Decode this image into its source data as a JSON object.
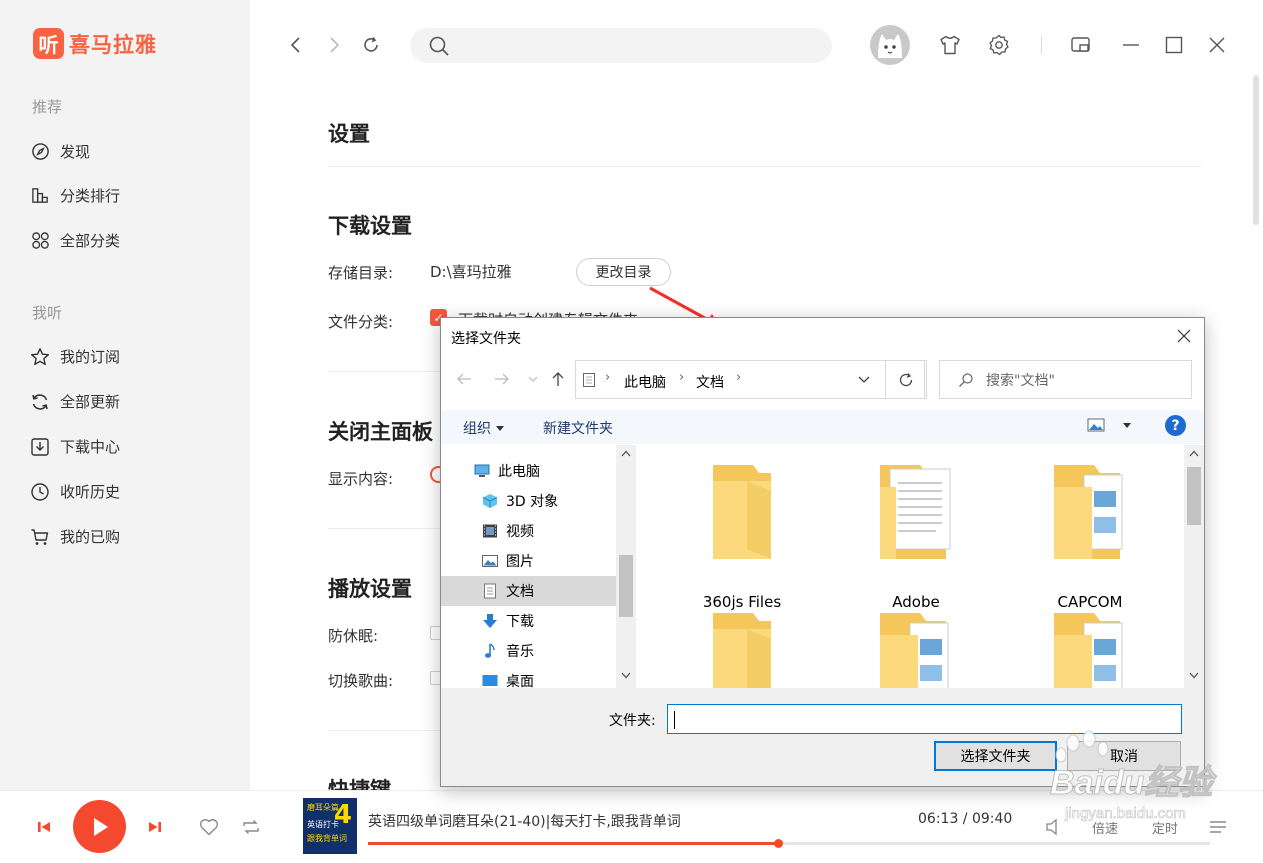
{
  "app": {
    "brand_glyph": "听",
    "brand_name": "喜马拉雅",
    "accent_color": "#f86442"
  },
  "sidebar": {
    "section_recommend": "推荐",
    "recommend_items": [
      {
        "label": "发现",
        "icon": "compass-icon"
      },
      {
        "label": "分类排行",
        "icon": "bar-chart-icon"
      },
      {
        "label": "全部分类",
        "icon": "grid-icon"
      }
    ],
    "section_mine": "我听",
    "mine_items": [
      {
        "label": "我的订阅",
        "icon": "star-icon"
      },
      {
        "label": "全部更新",
        "icon": "refresh-icon"
      },
      {
        "label": "下载中心",
        "icon": "download-icon"
      },
      {
        "label": "收听历史",
        "icon": "clock-icon"
      },
      {
        "label": "我的已购",
        "icon": "cart-icon"
      }
    ]
  },
  "settings": {
    "title": "设置",
    "download": {
      "heading": "下载设置",
      "storage_label": "存储目录:",
      "storage_path": "D:\\喜玛拉雅",
      "change_dir_button": "更改目录",
      "category_label": "文件分类:",
      "category_option": "下载时自动创建专辑文件夹",
      "category_checked": true
    },
    "close_panel": {
      "heading": "关闭主面板",
      "display_label": "显示内容:"
    },
    "playback": {
      "heading": "播放设置",
      "anti_sleep_label": "防休眠:",
      "switch_song_label": "切换歌曲:"
    },
    "shortcuts": {
      "heading": "快捷键"
    }
  },
  "dialog": {
    "title": "选择文件夹",
    "breadcrumb": [
      "此电脑",
      "文档"
    ],
    "search_placeholder": "搜索\"文档\"",
    "organize_label": "组织",
    "new_folder_label": "新建文件夹",
    "tree_items": [
      {
        "label": "此电脑",
        "icon": "computer-icon",
        "selected": false
      },
      {
        "label": "3D 对象",
        "icon": "cube-3d-icon",
        "selected": false
      },
      {
        "label": "视频",
        "icon": "video-icon",
        "selected": false
      },
      {
        "label": "图片",
        "icon": "picture-icon",
        "selected": false
      },
      {
        "label": "文档",
        "icon": "document-icon",
        "selected": true
      },
      {
        "label": "下载",
        "icon": "download-arrow-icon",
        "selected": false
      },
      {
        "label": "音乐",
        "icon": "music-note-icon",
        "selected": false
      },
      {
        "label": "桌面",
        "icon": "desktop-icon",
        "selected": false
      }
    ],
    "folders": [
      {
        "name": "360js Files",
        "variant": "plain"
      },
      {
        "name": "Adobe",
        "variant": "doc"
      },
      {
        "name": "CAPCOM",
        "variant": "pics"
      },
      {
        "name": "",
        "variant": "plain"
      },
      {
        "name": "",
        "variant": "pics"
      },
      {
        "name": "",
        "variant": "pics"
      }
    ],
    "folder_field_label": "文件夹:",
    "folder_field_value": "",
    "select_button": "选择文件夹",
    "cancel_button": "取消"
  },
  "player": {
    "track_title": "英语四级单词磨耳朵(21-40)|每天打卡,跟我背单词",
    "current_time": "06:13",
    "total_time": "09:40",
    "time_separator": " / ",
    "progress": 0.487,
    "speed_label": "倍速",
    "timer_label": "定时",
    "cover_text": "磨耳朵篇",
    "cover_number": "4",
    "cover_sub": "英语打卡",
    "cover_footer": "跟我背单词"
  },
  "watermark": {
    "brand": "Baidu经验",
    "url": "jingyan.baidu.com"
  }
}
